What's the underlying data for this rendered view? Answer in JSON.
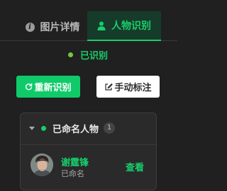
{
  "tabs": [
    {
      "label": "图片详情",
      "icon": "info-icon",
      "active": false
    },
    {
      "label": "人物识别",
      "icon": "person-icon",
      "active": true
    }
  ],
  "status": {
    "label": "已识别",
    "color": "#17cf6c"
  },
  "buttons": {
    "reidentify": {
      "label": "重新识别",
      "icon": "refresh-icon"
    },
    "manual_tag": {
      "label": "手动标注",
      "icon": "edit-icon"
    }
  },
  "group": {
    "title": "已命名人物",
    "count": "1",
    "collapsed": false
  },
  "people": [
    {
      "name": "谢霆锋",
      "status": "已命名",
      "action": "查看"
    }
  ],
  "colors": {
    "accent": "#17cf6c",
    "background": "#202020",
    "panel": "#2a2a2a"
  }
}
